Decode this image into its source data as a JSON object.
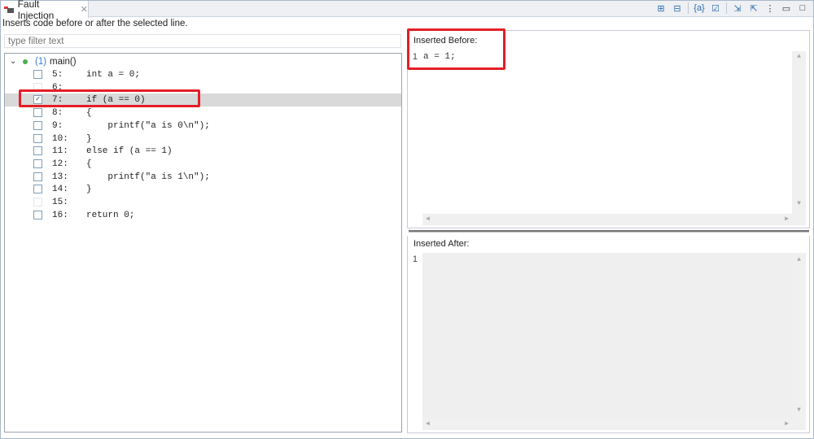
{
  "tab": {
    "title": "Fault Injection",
    "close": "✕"
  },
  "toolbar": [
    {
      "icon": "expand-all-icon",
      "g": "⊞"
    },
    {
      "icon": "collapse-all-icon",
      "g": "⊟"
    },
    {
      "icon": "variable-icon",
      "g": "{a}"
    },
    {
      "icon": "check-all-icon",
      "g": "☑"
    },
    {
      "icon": "import-icon",
      "g": "⇲"
    },
    {
      "icon": "export-icon",
      "g": "⇱"
    },
    {
      "icon": "view-menu-icon",
      "g": "⋮"
    },
    {
      "icon": "minimize-icon",
      "g": "▭"
    },
    {
      "icon": "maximize-icon",
      "g": "□"
    }
  ],
  "description": "Inserts code before or after the selected line.",
  "filter": {
    "placeholder": "type filter text",
    "value": ""
  },
  "tree": {
    "root": {
      "count": "(1)",
      "name": "main()"
    },
    "lines": [
      {
        "num": "5:",
        "code": "int a = 0;",
        "checked": false,
        "enabled": true
      },
      {
        "num": "6:",
        "code": "",
        "checked": false,
        "enabled": false
      },
      {
        "num": "7:",
        "code": "if (a == 0)",
        "checked": true,
        "enabled": true,
        "selected": true
      },
      {
        "num": "8:",
        "code": "{",
        "checked": false,
        "enabled": true
      },
      {
        "num": "9:",
        "code": "    printf(\"a is 0\\n\");",
        "checked": false,
        "enabled": true
      },
      {
        "num": "10:",
        "code": "}",
        "checked": false,
        "enabled": true
      },
      {
        "num": "11:",
        "code": "else if (a == 1)",
        "checked": false,
        "enabled": true
      },
      {
        "num": "12:",
        "code": "{",
        "checked": false,
        "enabled": true
      },
      {
        "num": "13:",
        "code": "    printf(\"a is 1\\n\");",
        "checked": false,
        "enabled": true
      },
      {
        "num": "14:",
        "code": "}",
        "checked": false,
        "enabled": true
      },
      {
        "num": "15:",
        "code": "",
        "checked": false,
        "enabled": false
      },
      {
        "num": "16:",
        "code": "return 0;",
        "checked": false,
        "enabled": true
      }
    ]
  },
  "before": {
    "label": "Inserted Before:",
    "line": "1",
    "code": "a = 1;"
  },
  "after": {
    "label": "Inserted After:",
    "line": "1",
    "code": ""
  },
  "colors": {
    "highlight": "#e41e26",
    "selection": "#d9d9d9"
  }
}
